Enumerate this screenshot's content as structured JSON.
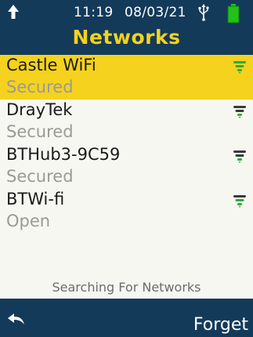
{
  "status": {
    "time": "11:19",
    "date": "08/03/21",
    "icons": [
      "up-arrow-icon",
      "usb-icon",
      "battery-icon"
    ]
  },
  "header": {
    "title": "Networks"
  },
  "networks": [
    {
      "name": "Castle WiFi",
      "security": "Secured",
      "selected": true
    },
    {
      "name": "DrayTek",
      "security": "Secured",
      "selected": false
    },
    {
      "name": "BTHub3-9C59",
      "security": "Secured",
      "selected": false
    },
    {
      "name": "BTWi-fi",
      "security": "Open",
      "selected": false
    }
  ],
  "footer_status": "Searching For Networks",
  "bottom_bar": {
    "back_icon": "back-arrow-icon",
    "forget_label": "Forget"
  },
  "colors": {
    "bar": "#143a5a",
    "accent": "#f4d21e",
    "wifi_green": "#2eaa3c",
    "battery_green": "#22c21a"
  }
}
